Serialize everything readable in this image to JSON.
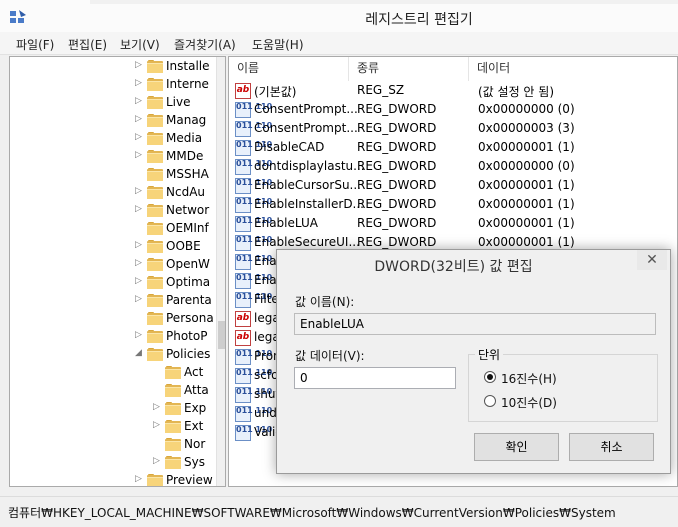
{
  "window": {
    "title": "레지스트리 편집기"
  },
  "menu": [
    "파일(F)",
    "편집(E)",
    "보기(V)",
    "즐겨찾기(A)",
    "도움말(H)"
  ],
  "tree": {
    "items": [
      {
        "label": "Installe",
        "expander": "collapsed",
        "level": 0
      },
      {
        "label": "Interne",
        "expander": "collapsed",
        "level": 0
      },
      {
        "label": "Live",
        "expander": "collapsed",
        "level": 0
      },
      {
        "label": "Manag",
        "expander": "collapsed",
        "level": 0
      },
      {
        "label": "Media",
        "expander": "collapsed",
        "level": 0
      },
      {
        "label": "MMDe",
        "expander": "collapsed",
        "level": 0
      },
      {
        "label": "MSSHA",
        "expander": "none",
        "level": 0
      },
      {
        "label": "NcdAu",
        "expander": "collapsed",
        "level": 0
      },
      {
        "label": "Networ",
        "expander": "collapsed",
        "level": 0
      },
      {
        "label": "OEMInf",
        "expander": "none",
        "level": 0
      },
      {
        "label": "OOBE",
        "expander": "collapsed",
        "level": 0
      },
      {
        "label": "OpenW",
        "expander": "collapsed",
        "level": 0
      },
      {
        "label": "Optima",
        "expander": "collapsed",
        "level": 0
      },
      {
        "label": "Parenta",
        "expander": "collapsed",
        "level": 0
      },
      {
        "label": "Persona",
        "expander": "none",
        "level": 0
      },
      {
        "label": "PhotoP",
        "expander": "collapsed",
        "level": 0
      },
      {
        "label": "Policies",
        "expander": "expanded",
        "level": 0
      },
      {
        "label": "Act",
        "expander": "none",
        "level": 1
      },
      {
        "label": "Atta",
        "expander": "none",
        "level": 1
      },
      {
        "label": "Exp",
        "expander": "collapsed",
        "level": 1
      },
      {
        "label": "Ext",
        "expander": "collapsed",
        "level": 1
      },
      {
        "label": "Nor",
        "expander": "none",
        "level": 1
      },
      {
        "label": "Sys",
        "expander": "collapsed",
        "level": 1
      },
      {
        "label": "Preview",
        "expander": "collapsed",
        "level": 0
      }
    ]
  },
  "list": {
    "columns": [
      "이름",
      "종류",
      "데이터"
    ],
    "rows": [
      {
        "icon": "string-value-icon",
        "name": "(기본값)",
        "type": "REG_SZ",
        "data": "(값 설정 안 됨)"
      },
      {
        "icon": "binary-value-icon",
        "name": "ConsentPrompt...",
        "type": "REG_DWORD",
        "data": "0x00000000 (0)"
      },
      {
        "icon": "binary-value-icon",
        "name": "ConsentPrompt...",
        "type": "REG_DWORD",
        "data": "0x00000003 (3)"
      },
      {
        "icon": "binary-value-icon",
        "name": "DisableCAD",
        "type": "REG_DWORD",
        "data": "0x00000001 (1)"
      },
      {
        "icon": "binary-value-icon",
        "name": "dontdisplaylastu...",
        "type": "REG_DWORD",
        "data": "0x00000000 (0)"
      },
      {
        "icon": "binary-value-icon",
        "name": "EnableCursorSu...",
        "type": "REG_DWORD",
        "data": "0x00000001 (1)"
      },
      {
        "icon": "binary-value-icon",
        "name": "EnableInstallerD...",
        "type": "REG_DWORD",
        "data": "0x00000001 (1)"
      },
      {
        "icon": "binary-value-icon",
        "name": "EnableLUA",
        "type": "REG_DWORD",
        "data": "0x00000001 (1)"
      },
      {
        "icon": "binary-value-icon",
        "name": "EnableSecureUI...",
        "type": "REG_DWORD",
        "data": "0x00000001 (1)"
      },
      {
        "icon": "binary-value-icon",
        "name": "Enab",
        "type": "",
        "data": ""
      },
      {
        "icon": "binary-value-icon",
        "name": "Enab",
        "type": "",
        "data": ""
      },
      {
        "icon": "binary-value-icon",
        "name": "Filte",
        "type": "",
        "data": ""
      },
      {
        "icon": "string-value-icon",
        "name": "lega",
        "type": "",
        "data": ""
      },
      {
        "icon": "string-value-icon",
        "name": "lega",
        "type": "",
        "data": ""
      },
      {
        "icon": "binary-value-icon",
        "name": "Pron",
        "type": "",
        "data": ""
      },
      {
        "icon": "binary-value-icon",
        "name": "scfo",
        "type": "",
        "data": ""
      },
      {
        "icon": "binary-value-icon",
        "name": "shut",
        "type": "",
        "data": ""
      },
      {
        "icon": "binary-value-icon",
        "name": "undo",
        "type": "",
        "data": ""
      },
      {
        "icon": "binary-value-icon",
        "name": "Valid",
        "type": "",
        "data": ""
      }
    ]
  },
  "status": {
    "path": "컴퓨터₩HKEY_LOCAL_MACHINE₩SOFTWARE₩Microsoft₩Windows₩CurrentVersion₩Policies₩System"
  },
  "dialog": {
    "title": "DWORD(32비트) 값 편집",
    "close_glyph": "✕",
    "value_name_label": "값 이름(N):",
    "value_name": "EnableLUA",
    "value_data_label": "값 데이터(V):",
    "value_data": "0",
    "base_label": "단위",
    "radio_hex": "16진수(H)",
    "radio_dec": "10진수(D)",
    "selected_base": "hex",
    "ok": "확인",
    "cancel": "취소"
  }
}
